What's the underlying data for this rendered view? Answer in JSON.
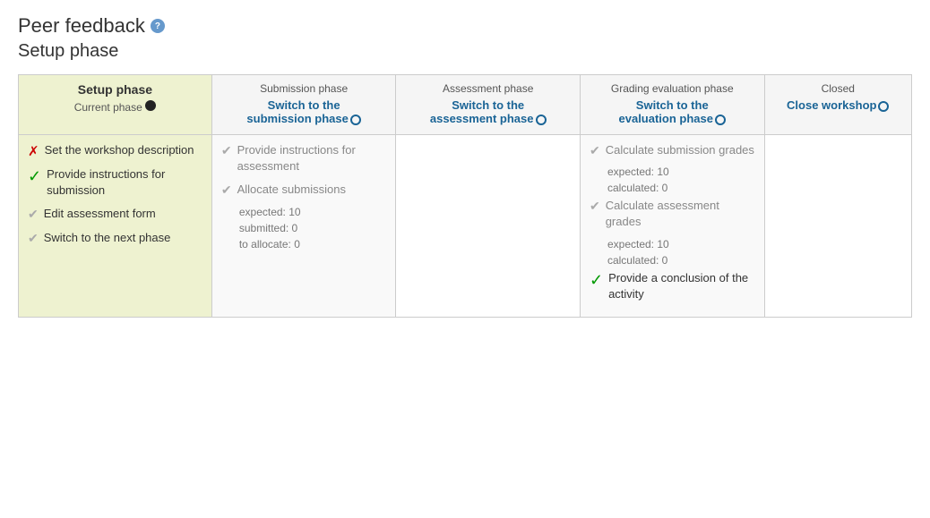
{
  "page": {
    "title": "Peer feedback",
    "help_icon": "?",
    "subtitle": "Setup phase"
  },
  "phases": {
    "setup": {
      "header": "Setup phase",
      "current_label": "Current phase",
      "tasks": [
        {
          "icon": "cross",
          "text": "Set the workshop description"
        },
        {
          "icon": "check",
          "text": "Provide instructions for submission"
        },
        {
          "icon": "half",
          "text": "Edit assessment form"
        },
        {
          "icon": "half",
          "text": "Switch to the next phase"
        }
      ]
    },
    "submission": {
      "name": "Submission phase",
      "link_line1": "Switch to the",
      "link_line2": "submission phase",
      "tasks": [
        {
          "icon": "half",
          "text": "Provide instructions for assessment"
        },
        {
          "icon": "half",
          "text": "Allocate submissions",
          "subs": [
            "expected: 10",
            "submitted: 0",
            "to allocate: 0"
          ]
        }
      ]
    },
    "assessment": {
      "name": "Assessment phase",
      "link_line1": "Switch to the",
      "link_line2": "assessment phase",
      "tasks": []
    },
    "grading": {
      "name": "Grading evaluation phase",
      "link_line1": "Switch to the",
      "link_line2": "evaluation phase",
      "tasks": [
        {
          "icon": "half",
          "text": "Calculate submission grades",
          "subs": [
            "expected: 10",
            "calculated: 0"
          ]
        },
        {
          "icon": "half",
          "text": "Calculate assessment grades",
          "subs": [
            "expected: 10",
            "calculated: 0"
          ]
        },
        {
          "icon": "check",
          "text": "Provide a conclusion of the activity"
        }
      ]
    },
    "closed": {
      "name": "Closed",
      "link_line1": "Close workshop"
    }
  }
}
